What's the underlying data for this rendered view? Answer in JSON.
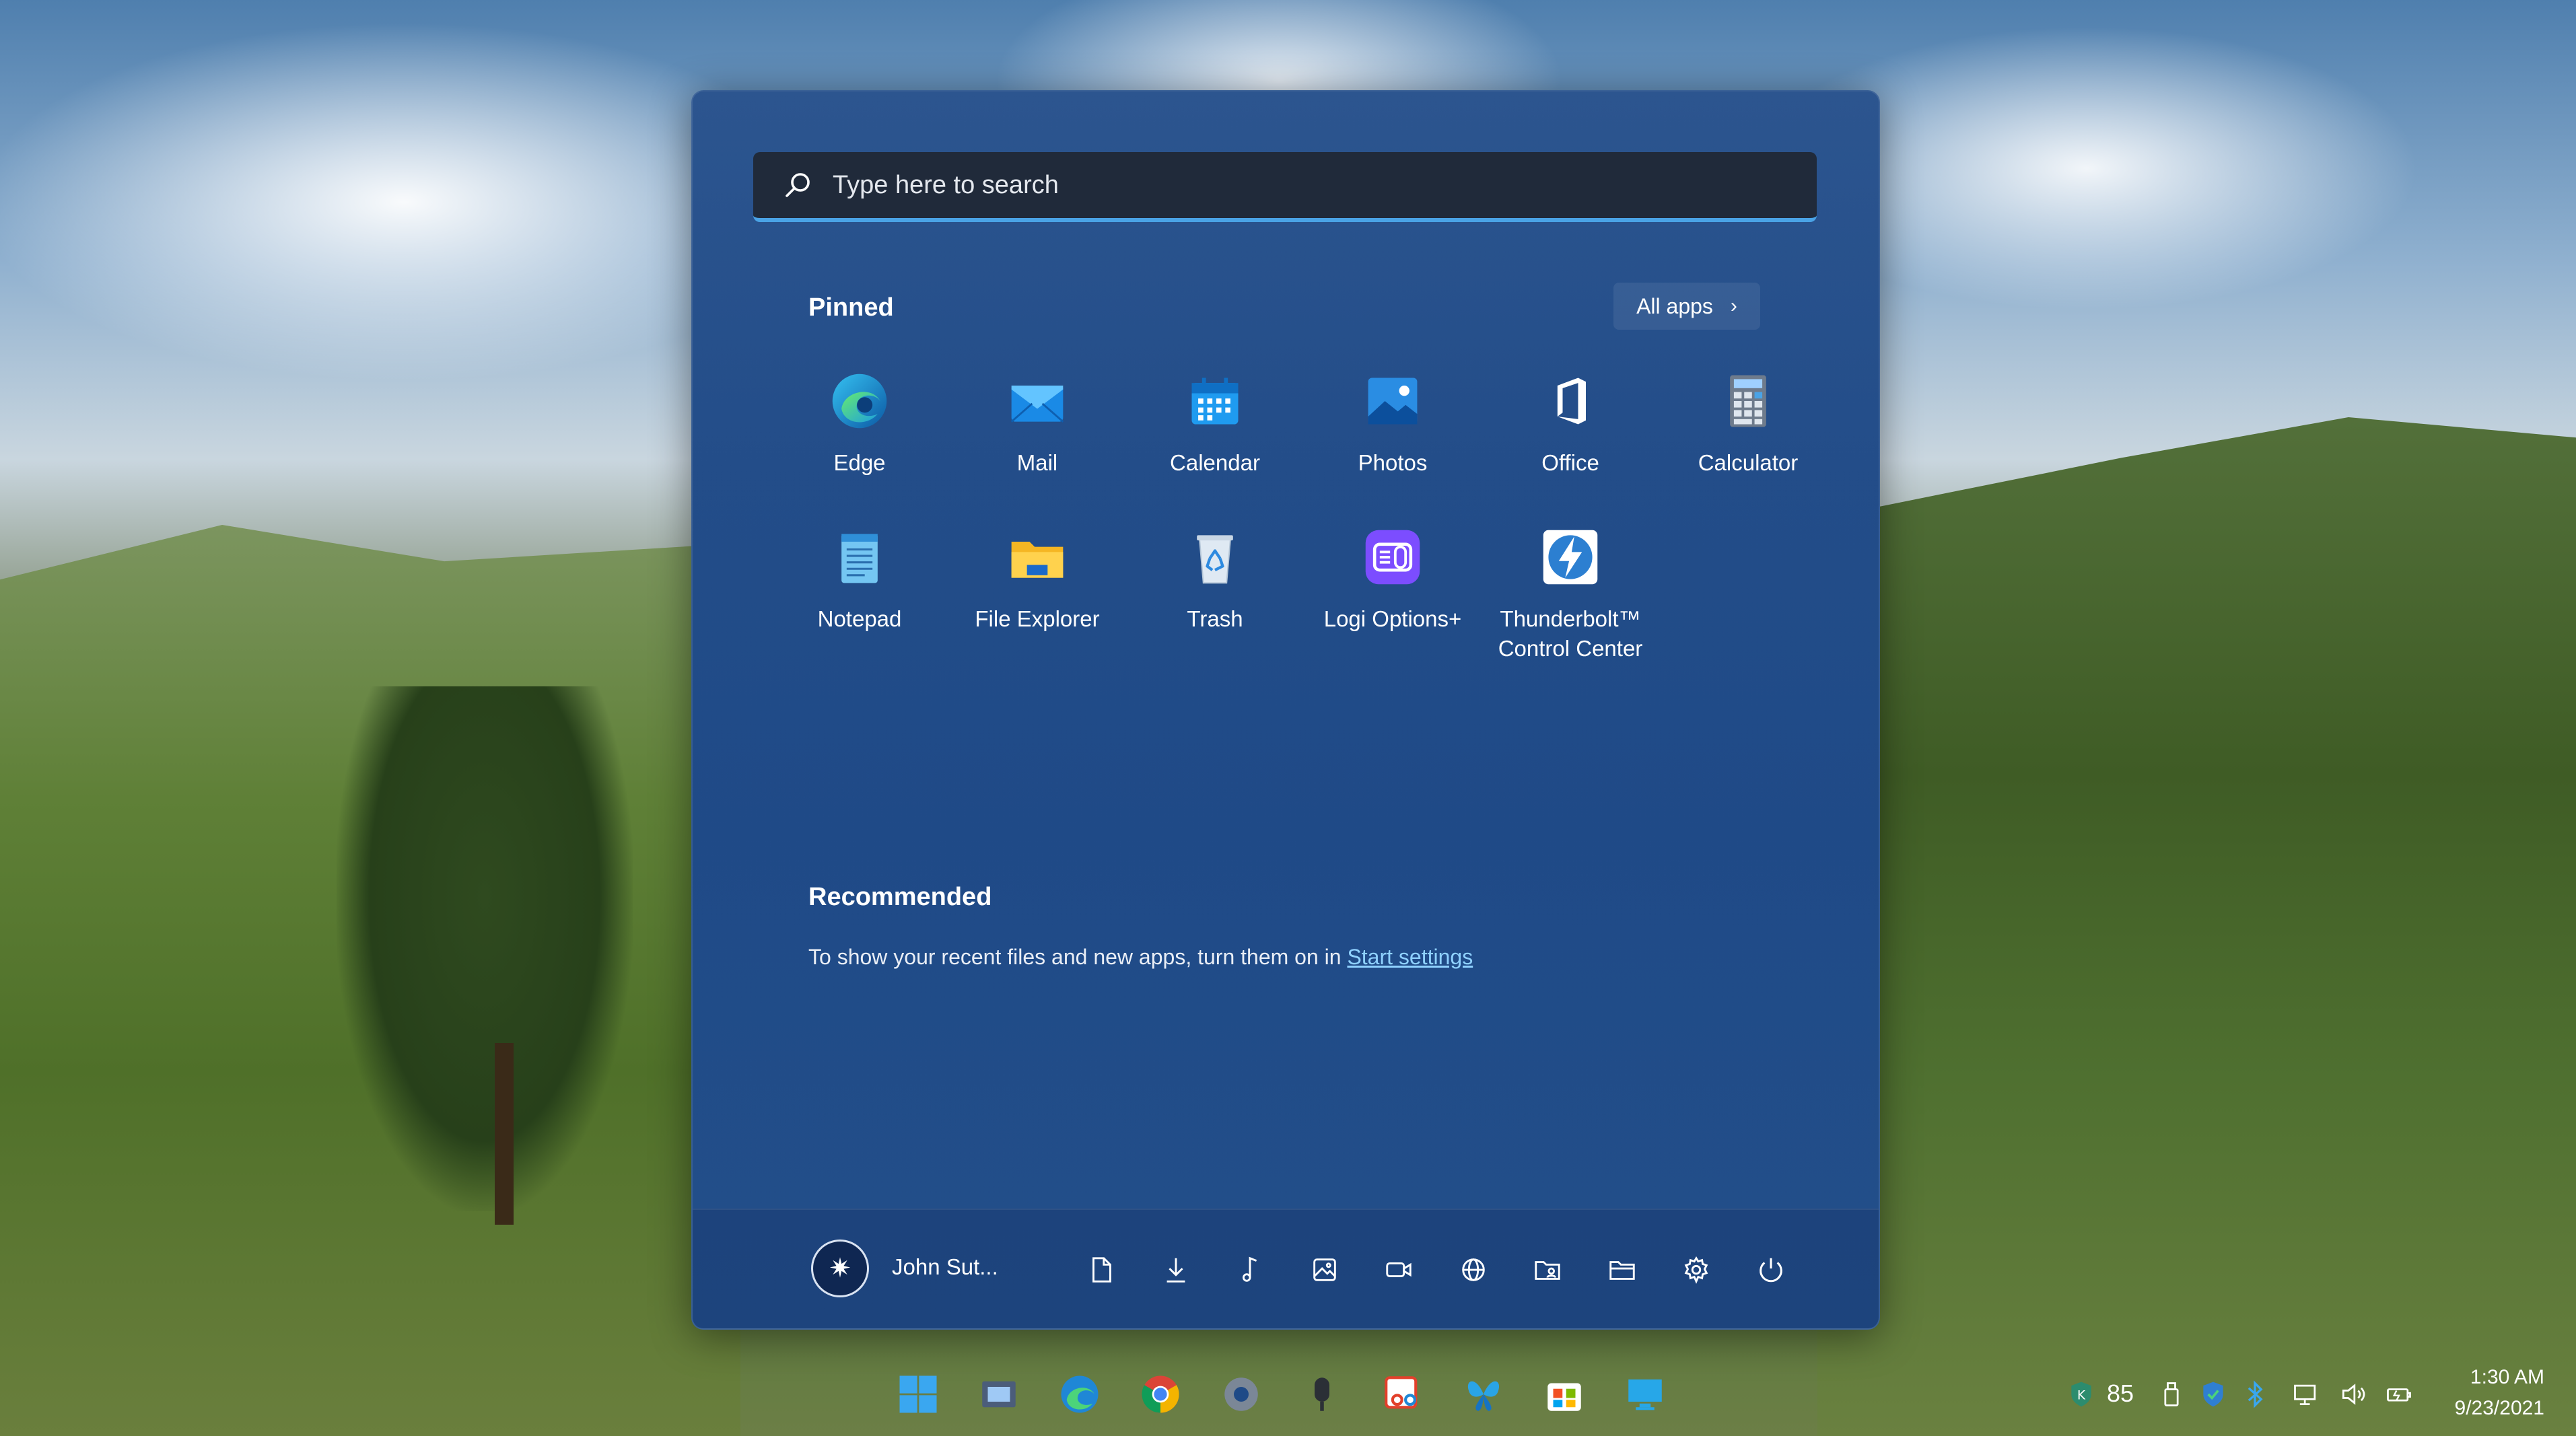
{
  "search": {
    "placeholder": "Type here to search"
  },
  "pinned": {
    "title": "Pinned",
    "all_apps_label": "All apps",
    "apps": [
      {
        "label": "Edge",
        "icon": "edge-icon"
      },
      {
        "label": "Mail",
        "icon": "mail-icon"
      },
      {
        "label": "Calendar",
        "icon": "calendar-icon"
      },
      {
        "label": "Photos",
        "icon": "photos-icon"
      },
      {
        "label": "Office",
        "icon": "office-icon"
      },
      {
        "label": "Calculator",
        "icon": "calculator-icon"
      },
      {
        "label": "Notepad",
        "icon": "notepad-icon"
      },
      {
        "label": "File Explorer",
        "icon": "folder-icon"
      },
      {
        "label": "Trash",
        "icon": "recycle-bin-icon"
      },
      {
        "label": "Logi Options+",
        "icon": "logi-options-icon"
      },
      {
        "label": "Thunderbolt™\nControl Center",
        "icon": "thunderbolt-icon"
      }
    ]
  },
  "recommended": {
    "title": "Recommended",
    "text_before": "To show your recent files and new apps, turn them on in ",
    "link_text": "Start settings"
  },
  "user": {
    "name": "John Sut..."
  },
  "bottom_bar_icons": [
    "documents-icon",
    "downloads-icon",
    "music-icon",
    "pictures-icon",
    "videos-icon",
    "network-icon",
    "personal-folder-icon",
    "file-explorer-icon",
    "settings-icon",
    "power-icon"
  ],
  "taskbar": {
    "icons": [
      "start-icon",
      "task-view-icon",
      "edge-icon",
      "chrome-icon",
      "settings-icon",
      "microphone-icon",
      "snipping-tool-icon",
      "butterfly-app-icon",
      "microsoft-store-icon",
      "remote-desktop-icon"
    ]
  },
  "tray": {
    "count": "85",
    "icons": [
      "antivirus-icon",
      "usb-icon",
      "security-icon",
      "bluetooth-icon",
      "network-icon",
      "volume-icon",
      "battery-icon"
    ]
  },
  "clock": {
    "time": "1:30 AM",
    "date": "9/23/2021"
  },
  "colors": {
    "accent": "#4aa3e6",
    "menu_bg": "#234d89",
    "link": "#8fd1ff"
  }
}
